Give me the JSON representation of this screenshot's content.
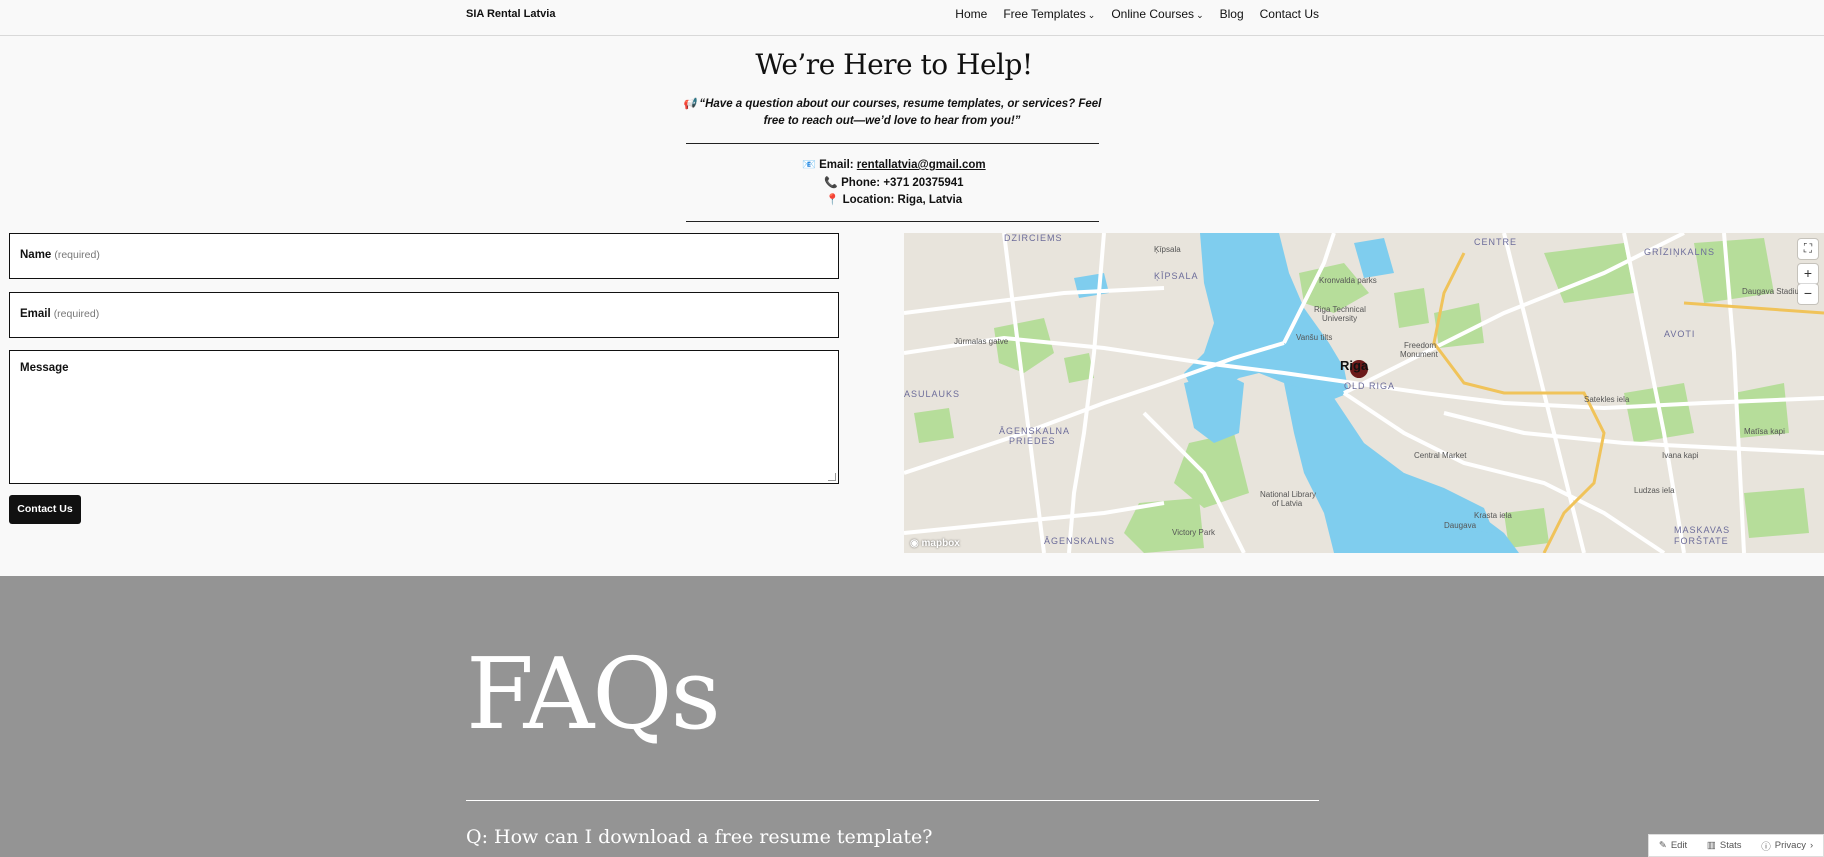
{
  "header": {
    "site_title": "SIA Rental Latvia",
    "nav": [
      {
        "label": "Home",
        "has_dropdown": false
      },
      {
        "label": "Free Templates",
        "has_dropdown": true
      },
      {
        "label": "Online Courses",
        "has_dropdown": true
      },
      {
        "label": "Blog",
        "has_dropdown": false
      },
      {
        "label": "Contact Us",
        "has_dropdown": false
      }
    ]
  },
  "hero": {
    "title": "We’re Here to Help!",
    "quote_icon": "📢",
    "quote_line1": "“Have a question about our courses, resume templates, or services? Feel",
    "quote_line2": "free to reach out—we’d love to hear from you!”"
  },
  "contact": {
    "email_icon": "📧",
    "email_label": "Email:",
    "email_value": "rentallatvia@gmail.com",
    "phone_icon": "📞",
    "phone_label": "Phone:",
    "phone_value": "+371 20375941",
    "location_icon": "📍",
    "location_label": "Location:",
    "location_value": "Riga, Latvia"
  },
  "form": {
    "name_label": "Name",
    "name_required": "(required)",
    "email_label": "Email",
    "email_required": "(required)",
    "message_label": "Message",
    "submit_label": "Contact Us"
  },
  "map": {
    "labels": {
      "dzirciems": "DZIRCIEMS",
      "kipsala_district": "ĶĪPSALA",
      "kipsala": "Ķīpsala",
      "centre": "CENTRE",
      "grizinkalns": "GRĪZIŅKALNS",
      "avoti": "AVOTI",
      "asulauks": "ASULAUKS",
      "agenskalna_priedes1": "ĀGENSKALNA",
      "agenskalna_priedes2": "PRIEDES",
      "agenskalns": "ĀGENSKALNS",
      "maskavas1": "MASKAVAS",
      "maskavas2": "FORŠTATE",
      "old_riga": "OLD RIGA",
      "riga": "Riga",
      "kronvalda": "Kronvalda parks",
      "rtu1": "Riga Technical",
      "rtu2": "University",
      "freedom1": "Freedom",
      "freedom2": "Monument",
      "central_market": "Central Market",
      "national_library1": "National Library",
      "national_library2": "of Latvia",
      "victory_park": "Victory Park",
      "ivana_kapi": "Ivana kapi",
      "daugava": "Daugava",
      "daugava_stadium": "Daugava Stadium",
      "matisa_kapi": "Matīsa kapi",
      "jurmalas_gatve": "Jūrmalas gatve",
      "valdemara": "Vanšu tilts",
      "satekles": "Satekles iela",
      "ludzas": "Ludzas iela",
      "krasta": "Krasta iela"
    },
    "attribution": "mapbox",
    "zoom_in": "+",
    "zoom_out": "−",
    "fullscreen_icon": "fullscreen-icon",
    "colors": {
      "water": "#7fcdee",
      "land": "#e8e4dc",
      "park": "#b6dd9a",
      "road": "#ffffff",
      "major_road": "#f0c35a",
      "marker": "#6b1a1a"
    }
  },
  "faq": {
    "title": "FAQs",
    "question1": "Q: How can I download a free resume template?"
  },
  "admin_bar": {
    "edit": "Edit",
    "stats": "Stats",
    "privacy": "Privacy"
  }
}
